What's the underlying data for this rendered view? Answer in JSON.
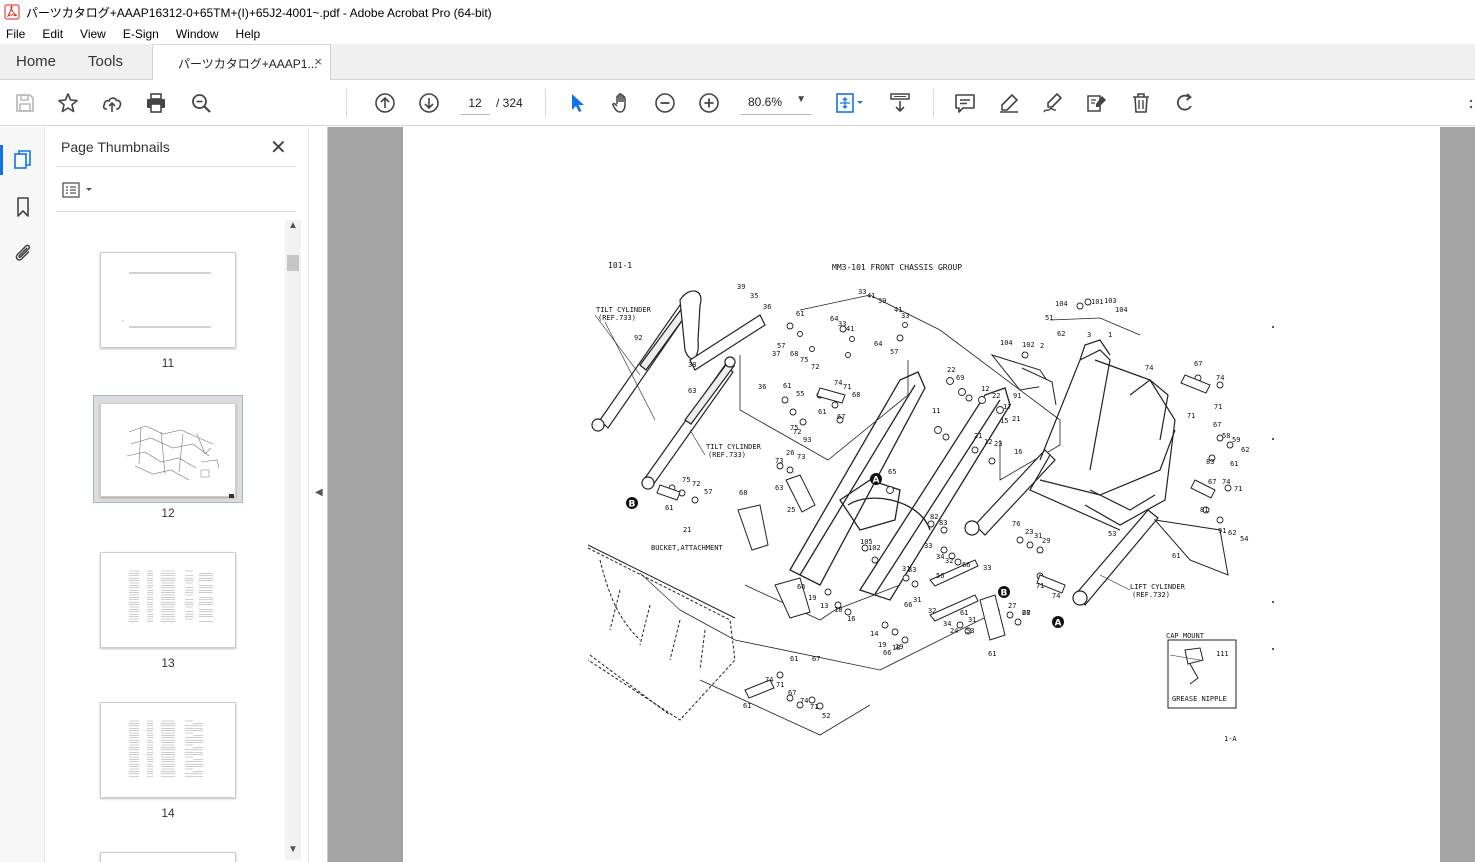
{
  "window": {
    "title": "パーツカタログ+AAAP16312-0+65TM+(I)+65J2-4001~.pdf - Adobe Acrobat Pro (64-bit)"
  },
  "menu": [
    "File",
    "Edit",
    "View",
    "E-Sign",
    "Window",
    "Help"
  ],
  "tabs": {
    "home": "Home",
    "tools": "Tools",
    "document": "パーツカタログ+AAAP1...",
    "close": "×"
  },
  "toolbar": {
    "page_current": "12",
    "page_total": "/ 324",
    "zoom": "80.6%",
    "icons": [
      "save-icon",
      "bookmark-star-icon",
      "upload-icon",
      "print-icon",
      "zoom-search-icon",
      "prev-page-icon",
      "next-page-icon",
      "select-arrow-icon",
      "hand-icon",
      "zoom-out-icon",
      "zoom-in-icon",
      "fit-page-icon",
      "scroll-mode-icon",
      "comment-icon",
      "highlight-icon",
      "sign-icon",
      "edit-icon",
      "delete-icon",
      "rotate-icon"
    ]
  },
  "panel": {
    "title": "Page Thumbnails",
    "close": "✕",
    "thumbnails": [
      {
        "label": "11"
      },
      {
        "label": "12",
        "selected": true
      },
      {
        "label": "13"
      },
      {
        "label": "14"
      }
    ]
  },
  "drawing": {
    "page_ref": "101-1",
    "title": "MM3-101   FRONT CHASSIS GROUP",
    "tilt_cylinder_a": "TILT CYLINDER",
    "tilt_ref_a": "(REF.733)",
    "tilt_cylinder_b": "TILT CYLINDER",
    "tilt_ref_b": "(REF.733)",
    "bucket": "BUCKET,ATTACHMENT",
    "lift_cylinder": "LIFT CYLINDER",
    "lift_ref": "(REF.732)",
    "cap_mount": "CAP MOUNT",
    "grease_nipple": "GREASE NIPPLE",
    "cap_num": "111",
    "footer": "1-A",
    "callout_a": "A",
    "callout_b": "B",
    "part_numbers": [
      "39",
      "35",
      "36",
      "38",
      "37",
      "36",
      "61",
      "57",
      "68",
      "75",
      "72",
      "33",
      "41",
      "39",
      "64",
      "33",
      "41",
      "41",
      "33",
      "64",
      "57",
      "61",
      "55",
      "61",
      "67",
      "74",
      "71",
      "68",
      "75",
      "72",
      "93",
      "92",
      "63",
      "26",
      "73",
      "73",
      "63",
      "25",
      "68",
      "75",
      "72",
      "57",
      "61",
      "21",
      "65",
      "22",
      "69",
      "11",
      "12",
      "22",
      "17",
      "21",
      "12",
      "91",
      "15",
      "21",
      "23",
      "16",
      "82",
      "83",
      "105",
      "102",
      "104",
      "102",
      "104",
      "101",
      "103",
      "104",
      "51",
      "62",
      "3",
      "2",
      "1",
      "67",
      "74",
      "71",
      "67",
      "74",
      "71",
      "58",
      "59",
      "62",
      "61",
      "83",
      "67",
      "74",
      "71",
      "81",
      "91",
      "62",
      "54",
      "61",
      "53",
      "71",
      "74",
      "67",
      "76",
      "23",
      "31",
      "29",
      "31",
      "33",
      "34",
      "32",
      "66",
      "33",
      "31",
      "32",
      "34",
      "61",
      "31",
      "33",
      "66",
      "24",
      "53",
      "61",
      "27",
      "28",
      "66",
      "19",
      "13",
      "18",
      "16",
      "14",
      "19",
      "18",
      "66",
      "29",
      "56",
      "61",
      "67",
      "74",
      "71",
      "67",
      "74",
      "71",
      "52",
      "61"
    ]
  }
}
